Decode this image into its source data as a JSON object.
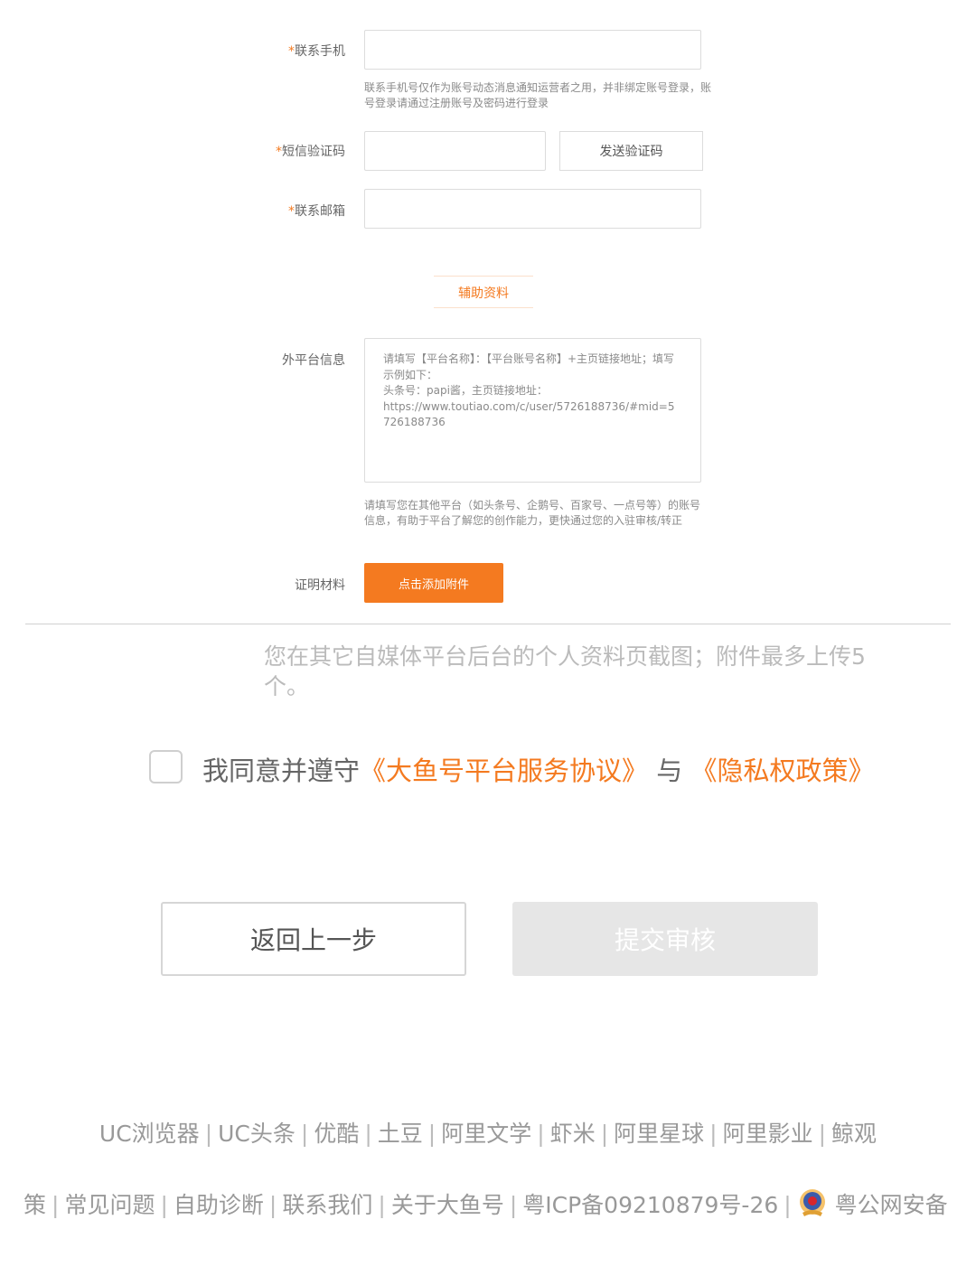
{
  "form": {
    "phone": {
      "required_mark": "*",
      "label": "联系手机",
      "value": "",
      "hint": "联系手机号仅作为账号动态消息通知运营者之用，并非绑定账号登录，账号登录请通过注册账号及密码进行登录"
    },
    "sms": {
      "required_mark": "*",
      "label": "短信验证码",
      "value": "",
      "send_label": "发送验证码"
    },
    "email": {
      "required_mark": "*",
      "label": "联系邮箱",
      "value": ""
    },
    "section_title": "辅助资料",
    "external": {
      "label": "外平台信息",
      "placeholder": "请填写【平台名称】：【平台账号名称】+主页链接地址；填写示例如下：\n头条号：papi酱，主页链接地址：\nhttps://www.toutiao.com/c/user/5726188736/#mid=5726188736",
      "hint": "请填写您在其他平台（如头条号、企鹅号、百家号、一点号等）的账号信息，有助于平台了解您的创作能力，更快通过您的入驻审核/转正"
    },
    "proof": {
      "label": "证明材料",
      "button": "点击添加附件"
    }
  },
  "attachment_hint": "您在其它自媒体平台后台的个人资料页截图；附件最多上传5个。",
  "agreement": {
    "checked": false,
    "prefix": "我同意并遵守",
    "link1": "《大鱼号平台服务协议》",
    "middle": "与",
    "link2": "《隐私权政策》"
  },
  "actions": {
    "back": "返回上一步",
    "submit": "提交审核"
  },
  "footer": {
    "row1": [
      "UC浏览器",
      "UC头条",
      "优酷",
      "土豆",
      "阿里文学",
      "虾米",
      "阿里星球",
      "阿里影业",
      "鲸观"
    ],
    "row2": [
      "策",
      "常见问题",
      "自助诊断",
      "联系我们",
      "关于大鱼号",
      "粤ICP备09210879号-26"
    ],
    "police": "粤公网安备"
  },
  "colors": {
    "accent": "#f47a20",
    "muted": "#999999"
  }
}
